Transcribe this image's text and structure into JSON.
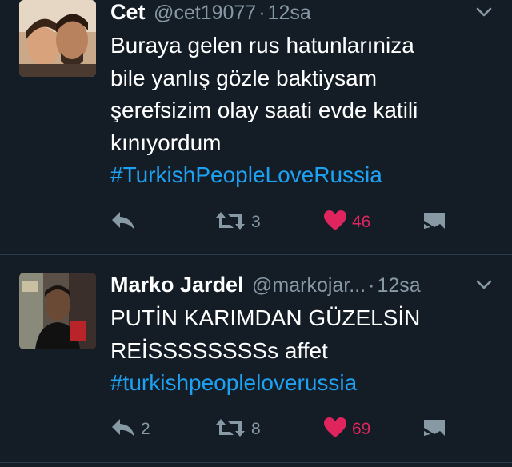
{
  "tweets": [
    {
      "name": "Cet",
      "handle": "@cet19077",
      "dot": "·",
      "time": "12sa",
      "avatar": "couple-selfie-avatar",
      "text_lines": [
        "Buraya gelen rus hatunlarıniza",
        "bile yanlış gözle baktiysam",
        "şerefsizim olay saati evde katili",
        "kınıyordum"
      ],
      "hashtag": "#TurkishPeopleLoveRussia",
      "reply_count": "",
      "retweet_count": "3",
      "like_count": "46",
      "liked": true
    },
    {
      "name": "Marko Jardel",
      "handle": "@markojar...",
      "dot": "·",
      "time": "12sa",
      "avatar": "man-portrait-avatar",
      "text_lines": [
        "PUTİN KARIMDAN GÜZELSİN",
        "REİSSSSSSSSs affet"
      ],
      "hashtag": "#turkishpeopleloverussia",
      "reply_count": "2",
      "retweet_count": "8",
      "like_count": "69",
      "liked": true
    }
  ],
  "colors": {
    "background": "#141d26",
    "text": "#ffffff",
    "secondary": "#8899a6",
    "link": "#1da1f2",
    "like": "#e0245e",
    "divider": "#2a3a4a"
  },
  "icons": [
    "reply-icon",
    "retweet-icon",
    "heart-icon",
    "message-icon",
    "chevron-down-icon"
  ]
}
